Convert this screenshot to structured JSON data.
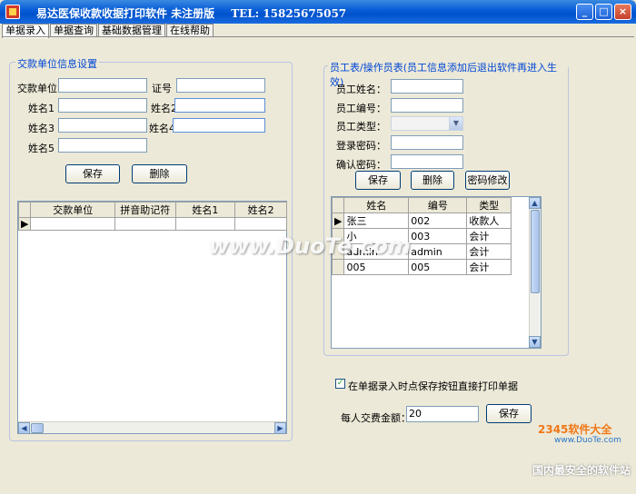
{
  "window": {
    "title": "易达医保收款收据打印软件 未注册版",
    "tel": "TEL: 15825675057",
    "minimize_glyph": "_",
    "maximize_glyph": "□",
    "close_glyph": "×"
  },
  "tabs": [
    "单据录入",
    "单据查询",
    "基础数据管理",
    "在线帮助"
  ],
  "payer_group": {
    "title": "交款单位信息设置",
    "labels": {
      "unit": "交款单位",
      "cert": "证号",
      "name1": "姓名1",
      "name2": "姓名2",
      "name3": "姓名3",
      "name4": "姓名4",
      "name5": "姓名5"
    },
    "save_label": "保存",
    "delete_label": "删除",
    "grid": {
      "columns": [
        "交款单位",
        "拼音助记符",
        "姓名1",
        "姓名2"
      ],
      "rows": []
    }
  },
  "staff_group": {
    "title": "员工表/操作员表(员工信息添加后退出软件再进入生效)",
    "labels": {
      "name": "员工姓名：",
      "id": "员工编号：",
      "type": "员工类型：",
      "login_pw": "登录密码：",
      "confirm_pw": "确认密码："
    },
    "save_label": "保存",
    "delete_label": "删除",
    "change_pw_label": "密码修改",
    "grid": {
      "columns": [
        "姓名",
        "编号",
        "类型"
      ],
      "rows": [
        {
          "name": "张三",
          "id": "002",
          "type": "收款人"
        },
        {
          "name": "小",
          "id": "003",
          "type": "会计"
        },
        {
          "name": "admin",
          "id": "admin",
          "type": "会计"
        },
        {
          "name": "005",
          "id": "005",
          "type": "会计"
        }
      ]
    }
  },
  "options": {
    "print_on_save_label": "在单据录入时点保存按钮直接打印单据",
    "print_on_save_checked": true,
    "fee_label": "每人交费金额：",
    "fee_value": "20",
    "fee_save_label": "保存"
  },
  "watermarks": {
    "center": "www.DuoTe.com",
    "logo_main": "2345软件大全",
    "logo_url": "www.DuoTe.com",
    "logo_tagline": "国内最安全的软件站"
  },
  "colors": {
    "titlebar": "#0052cc",
    "group_title": "#0046d5",
    "background": "#ece9d8"
  }
}
